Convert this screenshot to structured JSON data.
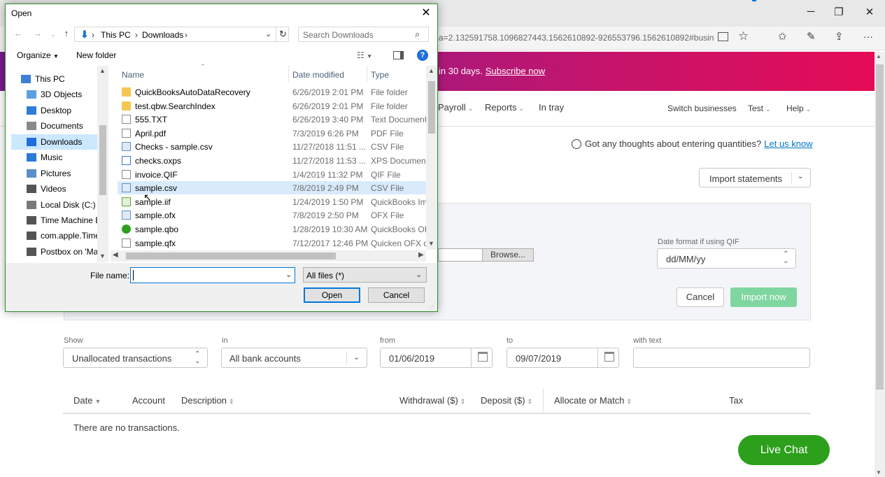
{
  "browser": {
    "url": "a=2.132591758.1096827443.1562610892-926553796.1562610892#busin",
    "minimize": "─",
    "restore": "❐",
    "close": "✕",
    "more": "···"
  },
  "promo": {
    "text": "in 30 days.",
    "link": "Subscribe now"
  },
  "nav": {
    "payroll": "Payroll",
    "reports": "Reports",
    "in_tray": "In tray",
    "switch_businesses": "Switch businesses",
    "test": "Test",
    "help": "Help"
  },
  "feedback": {
    "text": "Got any thoughts about entering quantities?",
    "link": "Let us know"
  },
  "import_statements": "Import statements",
  "import_panel": {
    "browse": "Browse...",
    "date_format_label": "Date format if using QIF",
    "date_format_value": "dd/MM/yy",
    "cancel": "Cancel",
    "import_now": "Import now"
  },
  "filters": {
    "show_label": "Show",
    "show_value": "Unallocated transactions",
    "in_label": "in",
    "in_value": "All bank accounts",
    "from_label": "from",
    "from_value": "01/06/2019",
    "to_label": "to",
    "to_value": "09/07/2019",
    "with_text_label": "with text",
    "with_text_value": ""
  },
  "table": {
    "columns": [
      "Date",
      "Account",
      "Description",
      "Withdrawal ($)",
      "Deposit ($)",
      "Allocate or Match",
      "Tax"
    ],
    "empty": "There are no transactions."
  },
  "live_chat": "Live Chat",
  "dialog": {
    "title": "Open",
    "path": [
      "This PC",
      "Downloads"
    ],
    "search_placeholder": "Search Downloads",
    "organize": "Organize",
    "new_folder": "New folder",
    "nav_items": [
      {
        "label": "This PC",
        "icon": "pc-icon"
      },
      {
        "label": "3D Objects",
        "icon": "cube-icon"
      },
      {
        "label": "Desktop",
        "icon": "desktop-icon"
      },
      {
        "label": "Documents",
        "icon": "documents-icon"
      },
      {
        "label": "Downloads",
        "icon": "download-icon"
      },
      {
        "label": "Music",
        "icon": "music-icon"
      },
      {
        "label": "Pictures",
        "icon": "pictures-icon"
      },
      {
        "label": "Videos",
        "icon": "videos-icon"
      },
      {
        "label": "Local Disk (C:)",
        "icon": "disk-icon"
      },
      {
        "label": "Time Machine B",
        "icon": "drive-icon"
      },
      {
        "label": "com.apple.Time",
        "icon": "drive-icon"
      },
      {
        "label": "Postbox on 'Mac",
        "icon": "drive-icon"
      }
    ],
    "columns": {
      "name": "Name",
      "date": "Date modified",
      "type": "Type"
    },
    "files": [
      {
        "name": "QuickBooksAutoDataRecovery",
        "date": "6/26/2019 2:01 PM",
        "type": "File folder",
        "icon": "folder-icon"
      },
      {
        "name": "test.qbw.SearchIndex",
        "date": "6/26/2019 2:01 PM",
        "type": "File folder",
        "icon": "folder-icon"
      },
      {
        "name": "555.TXT",
        "date": "6/26/2019 3:40 PM",
        "type": "Text Document",
        "icon": "text-file-icon"
      },
      {
        "name": "April.pdf",
        "date": "7/3/2019 6:26 PM",
        "type": "PDF File",
        "icon": "pdf-file-icon"
      },
      {
        "name": "Checks - sample.csv",
        "date": "11/27/2018 11:51 ...",
        "type": "CSV File",
        "icon": "csv-file-icon"
      },
      {
        "name": "checks.oxps",
        "date": "11/27/2018 11:53 ...",
        "type": "XPS Document",
        "icon": "xps-file-icon"
      },
      {
        "name": "invoice.QIF",
        "date": "1/4/2019 11:32 PM",
        "type": "QIF File",
        "icon": "file-icon"
      },
      {
        "name": "sample.csv",
        "date": "7/8/2019 2:49 PM",
        "type": "CSV File",
        "icon": "csv-file-icon"
      },
      {
        "name": "sample.iif",
        "date": "1/24/2019 1:50 PM",
        "type": "QuickBooks Imp",
        "icon": "iif-file-icon"
      },
      {
        "name": "sample.ofx",
        "date": "7/8/2019 2:50 PM",
        "type": "OFX File",
        "icon": "csv-file-icon"
      },
      {
        "name": "sample.qbo",
        "date": "1/28/2019 10:30 AM",
        "type": "QuickBooks OFX",
        "icon": "qb-file-icon"
      },
      {
        "name": "sample.qfx",
        "date": "7/12/2017 12:46 PM",
        "type": "Quicken OFX da",
        "icon": "file-icon"
      }
    ],
    "file_name_label": "File name:",
    "file_name_value": "",
    "file_type": "All files (*)",
    "open": "Open",
    "cancel": "Cancel"
  }
}
